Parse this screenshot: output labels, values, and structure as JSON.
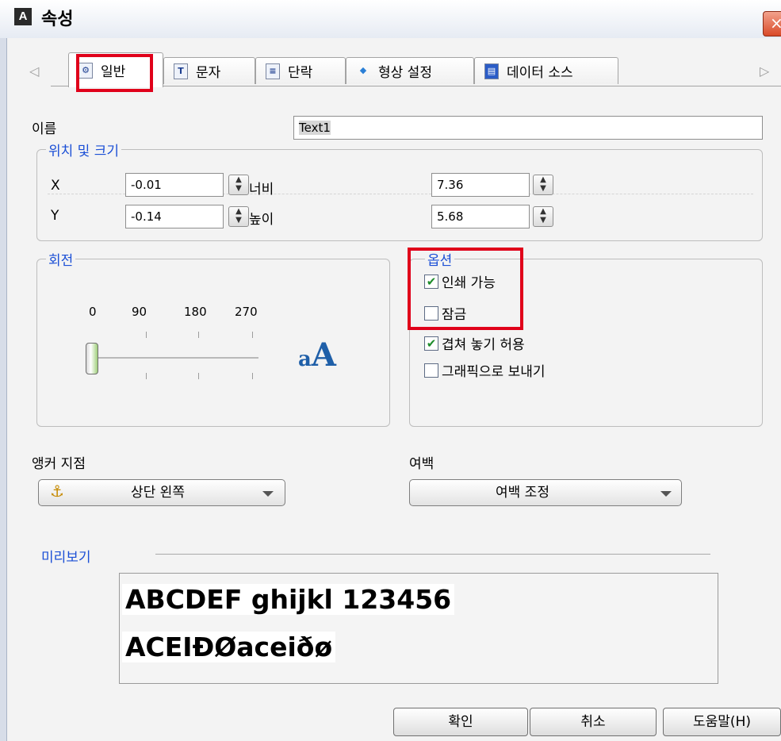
{
  "window": {
    "title": "속성",
    "close": "×"
  },
  "tabs": {
    "prev": "◁",
    "next": "▷",
    "items": [
      {
        "label": "일반",
        "icon": "gear-doc-icon"
      },
      {
        "label": "문자",
        "icon": "text-icon"
      },
      {
        "label": "단락",
        "icon": "paragraph-icon"
      },
      {
        "label": "형상 설정",
        "icon": "shape-icon"
      },
      {
        "label": "데이터 소스",
        "icon": "database-icon"
      }
    ]
  },
  "name": {
    "label": "이름",
    "value": "Text1"
  },
  "position_size": {
    "title": "위치 및 크기",
    "x_label": "X",
    "x_value": "-0.01",
    "y_label": "Y",
    "y_value": "-0.14",
    "width_label": "너비",
    "width_value": "7.36",
    "height_label": "높이",
    "height_value": "5.68"
  },
  "rotation": {
    "title": "회전",
    "ticks": [
      "0",
      "90",
      "180",
      "270"
    ],
    "value": 0,
    "preview_glyph_small": "a",
    "preview_glyph_large": "A"
  },
  "options": {
    "title": "옵션",
    "items": [
      {
        "label": "인쇄 가능",
        "checked": true
      },
      {
        "label": "잠금",
        "checked": false
      },
      {
        "label": "겹쳐 놓기 허용",
        "checked": true
      },
      {
        "label": "그래픽으로 보내기",
        "checked": false
      }
    ]
  },
  "anchor": {
    "label": "앵커 지점",
    "value": "상단 왼쪽",
    "icon": "anchor-icon"
  },
  "margin": {
    "label": "여백",
    "value": "여백 조정"
  },
  "preview": {
    "label": "미리보기",
    "line1": "ABCDEF ghijkl 123456",
    "line2": "ACEIÐØaceiðø"
  },
  "buttons": {
    "ok": "확인",
    "cancel": "취소",
    "help": "도움말(H)"
  },
  "colors": {
    "highlight": "#e0001a",
    "accent_text": "#1b4fd6",
    "check": "#1d8c2a"
  }
}
